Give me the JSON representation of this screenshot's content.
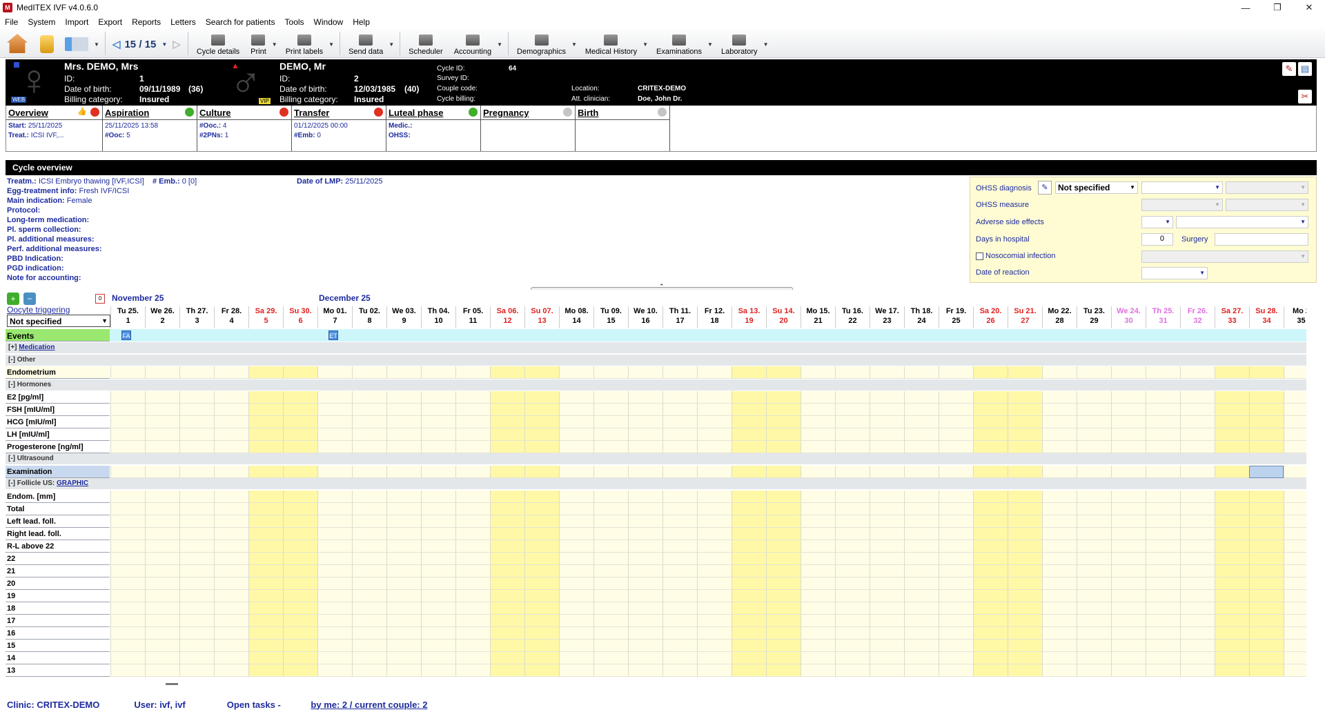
{
  "window": {
    "title": "MedITEX IVF v4.0.6.0",
    "app_icon": "meditex-logo-icon"
  },
  "menu": [
    "File",
    "System",
    "Import",
    "Export",
    "Reports",
    "Letters",
    "Search for patients",
    "Tools",
    "Window",
    "Help"
  ],
  "toolbar": {
    "counter": "15 / 15",
    "buttons": [
      "Cycle details",
      "Print",
      "Print labels",
      "Send data",
      "Scheduler",
      "Accounting",
      "Demographics",
      "Medical History",
      "Examinations",
      "Laboratory"
    ]
  },
  "patient": {
    "female": {
      "name": "Mrs. DEMO, Mrs",
      "id_label": "ID:",
      "id": "1",
      "dob_label": "Date of birth:",
      "dob": "09/11/1989",
      "age": "(36)",
      "billing_label": "Billing category:",
      "billing": "Insured",
      "web": "WEB"
    },
    "male": {
      "name": "DEMO, Mr",
      "id_label": "ID:",
      "id": "2",
      "dob_label": "Date of birth:",
      "dob": "12/03/1985",
      "age": "(40)",
      "billing_label": "Billing category:",
      "billing": "Insured",
      "vip": "VIP"
    },
    "cycle": {
      "cycle_id_label": "Cycle ID:",
      "cycle_id": "64",
      "survey_label": "Survey ID:",
      "couple_label": "Couple code:",
      "billing_label": "Cycle billing:",
      "location_label": "Location:",
      "location": "CRITEX-DEMO",
      "clinician_label": "Att. clinician:",
      "clinician": "Doe, John Dr."
    }
  },
  "stages": [
    {
      "title": "Overview",
      "status": "mixed",
      "lines": [
        [
          "Start:",
          "25/11/2025"
        ],
        [
          "Treat.:",
          "ICSI  IVF,..."
        ]
      ]
    },
    {
      "title": "Aspiration",
      "status": "ok",
      "lines": [
        [
          "",
          "25/11/2025 13:58"
        ],
        [
          "#Ooc:",
          "5"
        ]
      ]
    },
    {
      "title": "Culture",
      "status": "alert",
      "lines": [
        [
          "#Ooc.:",
          "4"
        ],
        [
          "#2PNs:",
          "1"
        ]
      ]
    },
    {
      "title": "Transfer",
      "status": "alert",
      "lines": [
        [
          "",
          "01/12/2025 00:00"
        ],
        [
          "#Emb:",
          "0"
        ]
      ]
    },
    {
      "title": "Luteal phase",
      "status": "ok",
      "lines": [
        [
          "Medic.:",
          ""
        ],
        [
          "OHSS:",
          ""
        ]
      ]
    },
    {
      "title": "Pregnancy",
      "status": "none",
      "lines": []
    },
    {
      "title": "Birth",
      "status": "none",
      "lines": []
    }
  ],
  "overview": {
    "title": "Cycle overview",
    "treatment_label": "Treatm.:",
    "treatment": "ICSI  Embryo thawing   [IVF,ICSI]",
    "emb_label": "# Emb.:",
    "emb": "0   [0]",
    "lmp_label": "Date of LMP:",
    "lmp": "25/11/2025",
    "egg_label": "Egg-treatment info:",
    "egg": "Fresh IVF/ICSI",
    "main_label": "Main indication:",
    "main": "Female",
    "other_labels": [
      "Protocol:",
      "Long-term medication:",
      "Pl. sperm collection:",
      "Pl. additional measures:",
      "Perf. additional measures:",
      "PBD Indication:",
      "PGD indication:",
      "Note for accounting:"
    ]
  },
  "ohss": {
    "diagnosis_label": "OHSS diagnosis",
    "diagnosis_value": "Not specified",
    "measure_label": "OHSS measure",
    "adverse_label": "Adverse side effects",
    "days_label": "Days in hospital",
    "days_value": "0",
    "surgery_label": "Surgery",
    "noso_label": "Nosocomial infection",
    "reaction_label": "Date of reaction"
  },
  "grid": {
    "months": [
      {
        "label": "November 25",
        "col": 0
      },
      {
        "label": "December 25",
        "col": 6
      }
    ],
    "oocyte_label": "Oocyte triggering",
    "oocyte_value": "Not specified",
    "days": [
      [
        "Tu 25.",
        "1"
      ],
      [
        "We 26.",
        "2"
      ],
      [
        "Th 27.",
        "3"
      ],
      [
        "Fr 28.",
        "4"
      ],
      [
        "Sa 29.",
        "5"
      ],
      [
        "Su 30.",
        "6"
      ],
      [
        "Mo 01.",
        "7"
      ],
      [
        "Tu 02.",
        "8"
      ],
      [
        "We 03.",
        "9"
      ],
      [
        "Th 04.",
        "10"
      ],
      [
        "Fr 05.",
        "11"
      ],
      [
        "Sa 06.",
        "12"
      ],
      [
        "Su 07.",
        "13"
      ],
      [
        "Mo 08.",
        "14"
      ],
      [
        "Tu 09.",
        "15"
      ],
      [
        "We 10.",
        "16"
      ],
      [
        "Th 11.",
        "17"
      ],
      [
        "Fr 12.",
        "18"
      ],
      [
        "Sa 13.",
        "19"
      ],
      [
        "Su 14.",
        "20"
      ],
      [
        "Mo 15.",
        "21"
      ],
      [
        "Tu 16.",
        "22"
      ],
      [
        "We 17.",
        "23"
      ],
      [
        "Th 18.",
        "24"
      ],
      [
        "Fr 19.",
        "25"
      ],
      [
        "Sa 20.",
        "26"
      ],
      [
        "Su 21.",
        "27"
      ],
      [
        "Mo 22.",
        "28"
      ],
      [
        "Tu 23.",
        "29"
      ],
      [
        "We 24.",
        "30"
      ],
      [
        "Th 25.",
        "31"
      ],
      [
        "Fr 26.",
        "32"
      ],
      [
        "Sa 27.",
        "33"
      ],
      [
        "Su 28.",
        "34"
      ],
      [
        "Mo 2",
        "35"
      ]
    ],
    "red_days": [
      4,
      5,
      11,
      12,
      18,
      19,
      25,
      26,
      32,
      33
    ],
    "pink_days": [
      29,
      30,
      31
    ],
    "events_label": "Events",
    "event_badges": [
      {
        "label": "FA",
        "col": 0
      },
      {
        "label": "ET",
        "col": 6
      }
    ],
    "groups": {
      "medication": {
        "prefix": "[+]",
        "label": "Medication"
      },
      "other": "[-]  Other",
      "hormones": "[-]  Hormones",
      "ultrasound": "[-]  Ultrasound",
      "follicle": {
        "prefix": "[-]  Follicle US:",
        "label": "GRAPHIC"
      }
    },
    "rows": {
      "endometrium": "Endometrium",
      "hormones": [
        "E2  [pg/ml]",
        "FSH  [mIU/ml]",
        "HCG  [mIU/ml]",
        "LH  [mIU/ml]",
        "Progesterone  [ng/ml]"
      ],
      "examination": "Examination",
      "follicle": [
        "Endom. [mm]",
        "Total",
        "Left lead. foll.",
        "Right lead. foll.",
        "R-L above 22",
        "22",
        "21",
        "20",
        "19",
        "18",
        "17",
        "16",
        "15",
        "14",
        "13"
      ]
    }
  },
  "footer": {
    "clinic": "Clinic: CRITEX-DEMO",
    "user": "User: ivf, ivf",
    "tasks_label": "Open tasks -",
    "tasks_link": "by me: 2 / current couple: 2"
  }
}
